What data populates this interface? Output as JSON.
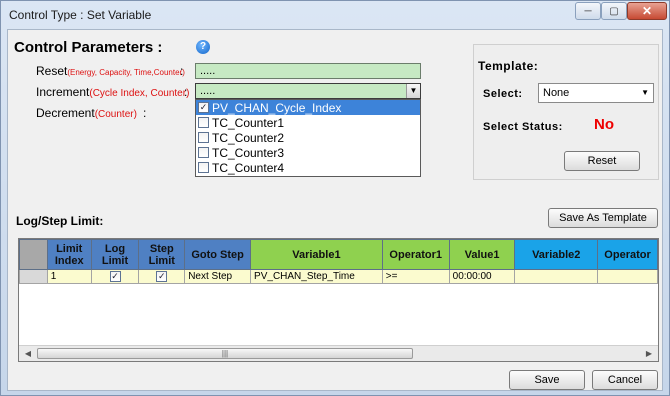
{
  "window": {
    "title": "Control Type : Set Variable",
    "min_glyph": "─",
    "max_glyph": "▢",
    "close_glyph": "✕"
  },
  "control_params": {
    "heading": "Control Parameters :",
    "help_glyph": "?",
    "reset": {
      "label": "Reset",
      "sub": "(Energy, Capacity, Time,Counter)",
      "colon": ":",
      "value": "....."
    },
    "increment": {
      "label": "Increment",
      "sub": "(Cycle Index, Counter)",
      "colon": ":",
      "value": "....."
    },
    "decrement": {
      "label": "Decrement",
      "sub": "(Counter)",
      "colon": ":"
    },
    "dropdown_items": [
      {
        "label": "PV_CHAN_Cycle_Index",
        "checked": true,
        "selected": true
      },
      {
        "label": "TC_Counter1",
        "checked": false,
        "selected": false
      },
      {
        "label": "TC_Counter2",
        "checked": false,
        "selected": false
      },
      {
        "label": "TC_Counter3",
        "checked": false,
        "selected": false
      },
      {
        "label": "TC_Counter4",
        "checked": false,
        "selected": false
      }
    ]
  },
  "template": {
    "title": "Template:",
    "select_label": "Select:",
    "select_value": "None",
    "status_label": "Select Status:",
    "status_value": "No",
    "reset_button": "Reset"
  },
  "log": {
    "title": "Log/Step Limit:",
    "save_template_button": "Save As Template",
    "columns": [
      "",
      "Limit Index",
      "Log Limit",
      "Step Limit",
      "Goto Step",
      "Variable1",
      "Operator1",
      "Value1",
      "Variable2",
      "Operator"
    ],
    "rows": [
      {
        "limit_index": "1",
        "log_limit": true,
        "step_limit": true,
        "goto_step": "Next Step",
        "variable1": "PV_CHAN_Step_Time",
        "operator1": ">=",
        "value1": "00:00:00",
        "variable2": "",
        "operator2": ""
      }
    ],
    "scroll_thumb_glyph": "|||"
  },
  "footer": {
    "save_button": "Save",
    "cancel_button": "Cancel"
  },
  "colors": {
    "field_green": "#c6e9c3",
    "header_blue": "#4f80c3",
    "header_green": "#8fd14f",
    "header_cyan": "#1aa3e8",
    "row_yellow": "#fbfbcf",
    "status_red": "#e00000",
    "selection_blue": "#3d83d9"
  }
}
